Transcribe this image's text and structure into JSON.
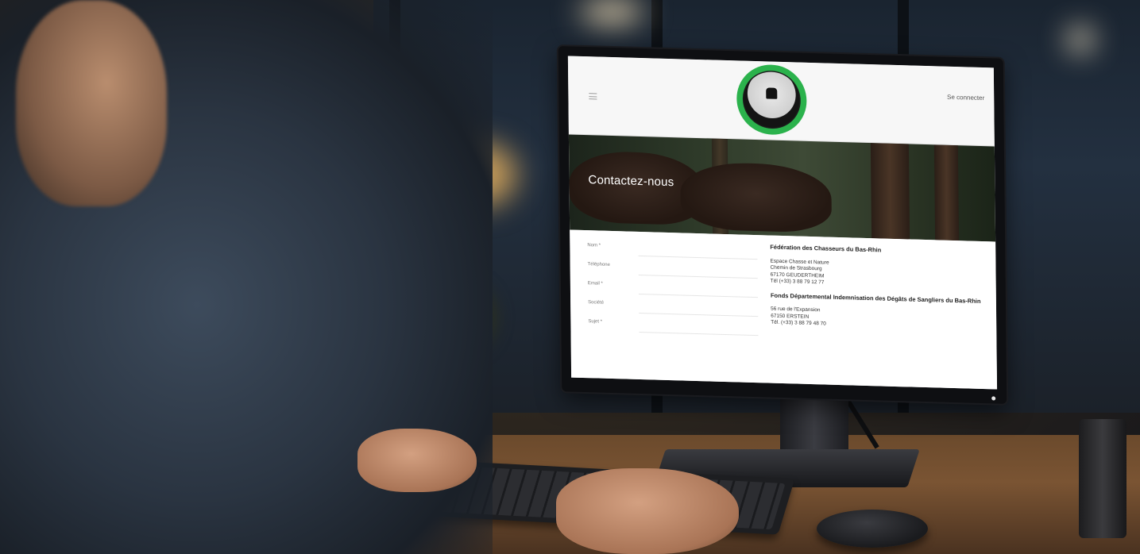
{
  "site": {
    "header": {
      "login_label": "Se connecter"
    },
    "hero": {
      "title": "Contactez-nous"
    },
    "form": {
      "fields": [
        {
          "label": "Nom *"
        },
        {
          "label": "Téléphone"
        },
        {
          "label": "Email *"
        },
        {
          "label": "Société"
        },
        {
          "label": "Sujet *"
        }
      ]
    },
    "contacts": [
      {
        "title": "Fédération des Chasseurs du Bas-Rhin",
        "lines": [
          "Espace Chasse et Nature",
          "Chemin de Strasbourg",
          "67170 GEUDERTHEIM",
          "Tél (+33) 3 88 79 12 77"
        ]
      },
      {
        "title": "Fonds Départemental Indemnisation des Dégâts de Sangliers du Bas-Rhin",
        "lines": [
          "56 rue de l'Expansion",
          "67150 ERSTEIN",
          "Tél. (+33) 3 88 79 48 70"
        ]
      }
    ]
  },
  "colors": {
    "logo_ring": "#2bb24c",
    "page_bg": "#f4f4f4",
    "hero_text": "#ffffff"
  },
  "icons": {
    "menu": "hamburger-menu-icon",
    "logo": "deer-emblem-logo"
  }
}
